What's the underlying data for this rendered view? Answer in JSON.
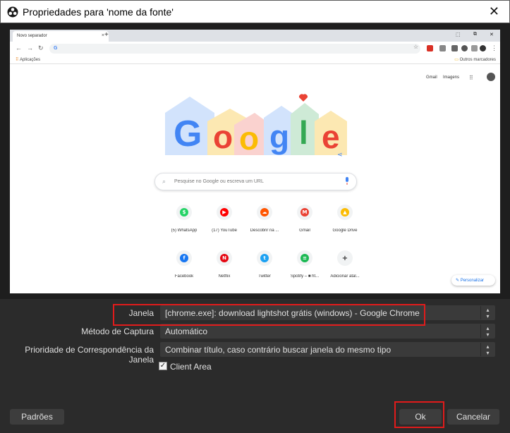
{
  "window": {
    "title": "Propriedades para 'nome da fonte'",
    "close_glyph": "✕"
  },
  "browser": {
    "tab_title": "Novo separador",
    "tab_close": "×",
    "new_tab": "+",
    "omnibox_text": "G",
    "bookmark_apps": "Aplicações",
    "bookmark_other": "Outros marcadores",
    "gmail_link": "Gmail",
    "images_link": "Imagens",
    "search_placeholder": "Pesquise no Google ou escreva um URL",
    "doodle_letters": "Google",
    "shortcuts": [
      {
        "label": "(5) WhatsApp",
        "icon": "whatsapp-icon",
        "color": "#25d366",
        "glyph": "$"
      },
      {
        "label": "(17) YouTube",
        "icon": "youtube-icon",
        "color": "#ff0000",
        "glyph": "▶"
      },
      {
        "label": "Descobrir na ...",
        "icon": "soundcloud-icon",
        "color": "#ff5500",
        "glyph": "☁"
      },
      {
        "label": "Gmail",
        "icon": "gmail-icon",
        "color": "#ea4335",
        "glyph": "M"
      },
      {
        "label": "Google Drive",
        "icon": "drive-icon",
        "color": "#fbbc04",
        "glyph": "▲"
      },
      {
        "label": "Facebook",
        "icon": "facebook-icon",
        "color": "#1877f2",
        "glyph": "f"
      },
      {
        "label": "Netflix",
        "icon": "netflix-icon",
        "color": "#e50914",
        "glyph": "N"
      },
      {
        "label": "Twitter",
        "icon": "twitter-icon",
        "color": "#1da1f2",
        "glyph": "t"
      },
      {
        "label": "Spotify – ■ ht...",
        "icon": "spotify-icon",
        "color": "#1db954",
        "glyph": "≡"
      },
      {
        "label": "Adicionar atal...",
        "icon": "add-shortcut-icon",
        "color": "#f1f3f4",
        "glyph": "+"
      }
    ],
    "personalize": "Personalizar"
  },
  "form": {
    "janela_label": "Janela",
    "janela_value": "[chrome.exe]: download lightshot grátis (windows) - Google Chrome",
    "metodo_label": "Método de Captura",
    "metodo_value": "Automático",
    "prioridade_label": "Prioridade de Correspondência da Janela",
    "prioridade_value": "Combinar título, caso contrário buscar janela do mesmo tipo",
    "client_area_label": "Client Area",
    "client_area_checked": true
  },
  "buttons": {
    "defaults": "Padrões",
    "ok": "Ok",
    "cancel": "Cancelar"
  },
  "colors": {
    "highlight": "#e11b1b",
    "dialog_bg": "#2b2b2b",
    "field_bg": "#3a3a3a"
  }
}
